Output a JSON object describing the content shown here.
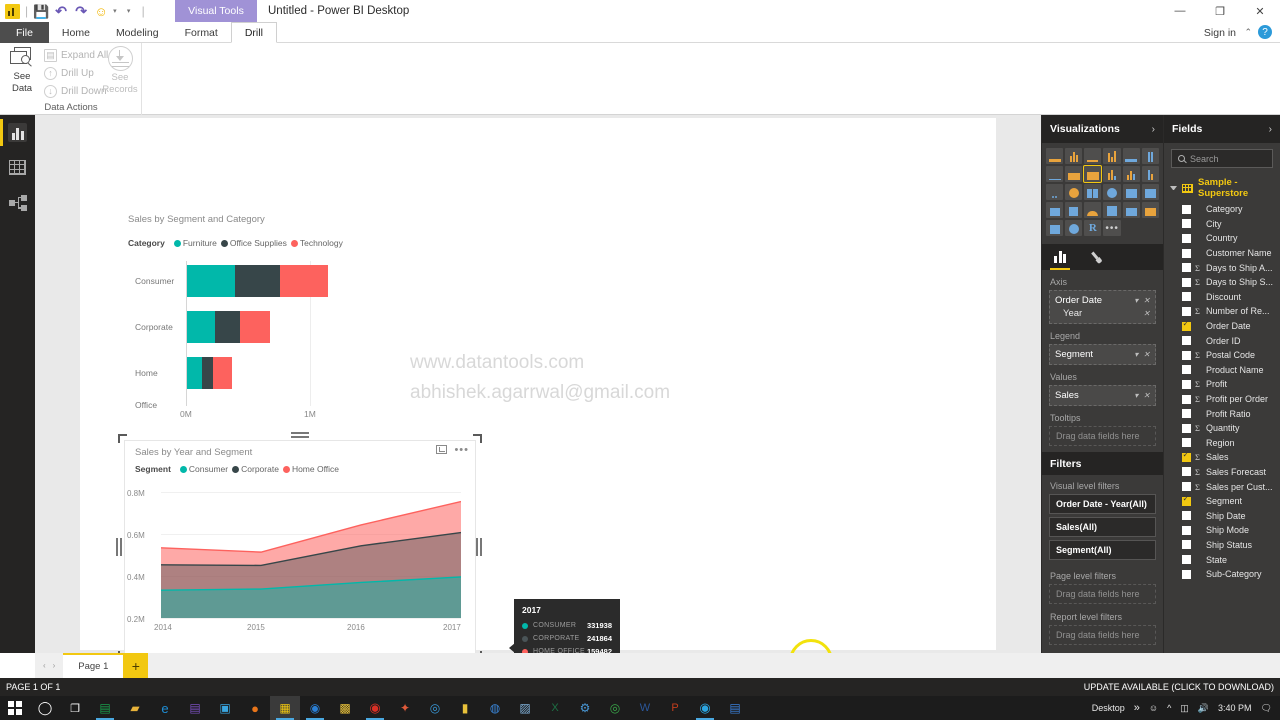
{
  "titlebar": {
    "quick_access": [
      "pbi-logo",
      "save-icon",
      "undo-icon",
      "redo-icon",
      "smiley-icon",
      "customize-caret"
    ],
    "contextual_tab": "Visual Tools",
    "window_title": "Untitled - Power BI Desktop",
    "minimize": "—",
    "maximize": "❐",
    "close": "✕"
  },
  "ribbon": {
    "tabs": [
      "File",
      "Home",
      "Modeling",
      "Format",
      "Drill"
    ],
    "active_tab": "Drill",
    "sign_in": "Sign in",
    "collapse_caret": "⌃",
    "help": "?",
    "group_label": "Data Actions",
    "see_data": "See\nData",
    "see_data_line1": "See",
    "see_data_line2": "Data",
    "commands": [
      "Expand All",
      "Drill Up",
      "Drill Down"
    ],
    "see_records_line1": "See",
    "see_records_line2": "Records"
  },
  "viewbar": {
    "items": [
      "report-view",
      "data-view",
      "model-view"
    ],
    "selected": "report-view"
  },
  "canvas": {
    "watermark_line1": "www.datantools.com",
    "watermark_line2": "abhishek.agarrwal@gmail.com"
  },
  "colors": {
    "consumer": "#01B8AA",
    "corporate": "#374649",
    "home_office": "#FD625E",
    "furniture": "#01B8AA",
    "office_supplies": "#374649",
    "technology": "#FD625E",
    "accent_yellow": "#F2C811",
    "panel_bg": "#3B3A39",
    "panel_head": "#252423",
    "cursor_ring": "#F2E20C"
  },
  "chart_data": [
    {
      "type": "bar",
      "id": "sales-by-segment-and-category",
      "title": "Sales by Segment and Category",
      "orientation": "horizontal",
      "stacked": true,
      "legend_title": "Category",
      "legend_position": "top",
      "categories": [
        "Consumer",
        "Corporate",
        "Home Office"
      ],
      "xlabel": "",
      "ylabel": "",
      "xlim": [
        0,
        1.15
      ],
      "xticks": [
        "0M",
        "1M"
      ],
      "xtick_values": [
        0,
        1000000
      ],
      "grid": false,
      "series": [
        {
          "name": "Furniture",
          "color": "#01B8AA",
          "values": [
            391000,
            230000,
            124000
          ]
        },
        {
          "name": "Office Supplies",
          "color": "#374649",
          "values": [
            366000,
            205000,
            89000
          ]
        },
        {
          "name": "Technology",
          "color": "#FD625E",
          "values": [
            391000,
            247000,
            158000
          ]
        }
      ],
      "totals": [
        1148000,
        682000,
        371000
      ],
      "units": "USD"
    },
    {
      "type": "area",
      "id": "sales-by-year-and-segment",
      "title": "Sales by Year and Segment",
      "stacked": true,
      "legend_title": "Segment",
      "legend_position": "top",
      "x": [
        "2014",
        "2015",
        "2016",
        "2017"
      ],
      "xlabel": "",
      "ylabel": "",
      "ylim": [
        0.2,
        0.85
      ],
      "yticks": [
        "0.2M",
        "0.4M",
        "0.6M",
        "0.8M"
      ],
      "ytick_values": [
        200000,
        400000,
        600000,
        800000
      ],
      "grid": true,
      "series": [
        {
          "name": "Consumer",
          "color": "#01B8AA",
          "values": [
            263000,
            269000,
            303000,
            331938
          ]
        },
        {
          "name": "Corporate",
          "color": "#374649",
          "values": [
            131000,
            128000,
            202000,
            241864
          ]
        },
        {
          "name": "Home Office",
          "color": "#FD625E",
          "values": [
            89000,
            77000,
            108000,
            159482
          ]
        }
      ],
      "cumulative": [
        [
          263000,
          269000,
          303000,
          331938
        ],
        [
          394000,
          397000,
          505000,
          573802
        ],
        [
          483000,
          474000,
          613000,
          733284
        ]
      ],
      "units": "USD"
    }
  ],
  "tooltip": {
    "title": "2017",
    "rows": [
      {
        "label": "CONSUMER",
        "value": "331938",
        "color": "#01B8AA"
      },
      {
        "label": "CORPORATE",
        "value": "241864",
        "color": "#374649"
      },
      {
        "label": "HOME OFFICE",
        "value": "159482",
        "color": "#FD625E"
      }
    ]
  },
  "visualizations": {
    "header": "Visualizations",
    "chevron": "›",
    "icon_grid": [
      "stacked-bar-chart-icon",
      "stacked-column-chart-icon",
      "clustered-bar-chart-icon",
      "clustered-column-chart-icon",
      "100-stacked-bar-chart-icon",
      "100-stacked-column-chart-icon",
      "line-chart-icon",
      "area-chart-icon",
      "stacked-area-chart-icon",
      "line-stacked-column-icon",
      "line-clustered-column-icon",
      "ribbon-chart-icon",
      "scatter-chart-icon",
      "pie-chart-icon",
      "treemap-icon",
      "map-icon",
      "filled-map-icon",
      "matrix-icon",
      "funnel-icon",
      "funnel-chart-icon",
      "gauge-icon",
      "card-icon",
      "multi-row-card-icon",
      "kpi-icon",
      "slicer-icon",
      "r-script-visual-icon",
      "r-letter-icon",
      "more-options-icon"
    ],
    "selected_icon": "stacked-area-chart-icon",
    "tabs": [
      "fields-pane-icon",
      "format-pane-icon"
    ],
    "active_tab": "fields-pane-icon",
    "wells": [
      {
        "label": "Axis",
        "value": "Order Date",
        "sub": "Year",
        "caret": "▾",
        "remove": "✕"
      },
      {
        "label": "Legend",
        "value": "Segment",
        "sub": null,
        "caret": "▾",
        "remove": "✕"
      },
      {
        "label": "Values",
        "value": "Sales",
        "sub": null,
        "caret": "▾",
        "remove": "✕"
      },
      {
        "label": "Tooltips",
        "value": null,
        "placeholder": "Drag data fields here"
      }
    ]
  },
  "filters": {
    "header": "Filters",
    "zones": [
      {
        "label": "Visual level filters",
        "cards": [
          "Order Date - Year(All)",
          "Sales(All)",
          "Segment(All)"
        ]
      },
      {
        "label": "Page level filters",
        "placeholder": "Drag data fields here"
      },
      {
        "label": "Report level filters",
        "placeholder": "Drag data fields here"
      }
    ]
  },
  "fields": {
    "header": "Fields",
    "chevron": "›",
    "search_placeholder": "Search",
    "table_name": "Sample - Superstore",
    "items": [
      {
        "name": "Category",
        "checked": false,
        "measure": false
      },
      {
        "name": "City",
        "checked": false,
        "measure": false
      },
      {
        "name": "Country",
        "checked": false,
        "measure": false
      },
      {
        "name": "Customer Name",
        "checked": false,
        "measure": false
      },
      {
        "name": "Days to Ship A...",
        "checked": false,
        "measure": true
      },
      {
        "name": "Days to Ship S...",
        "checked": false,
        "measure": true
      },
      {
        "name": "Discount",
        "checked": false,
        "measure": false
      },
      {
        "name": "Number of Re...",
        "checked": false,
        "measure": true
      },
      {
        "name": "Order Date",
        "checked": true,
        "measure": false
      },
      {
        "name": "Order ID",
        "checked": false,
        "measure": false
      },
      {
        "name": "Postal Code",
        "checked": false,
        "measure": true
      },
      {
        "name": "Product Name",
        "checked": false,
        "measure": false
      },
      {
        "name": "Profit",
        "checked": false,
        "measure": true
      },
      {
        "name": "Profit per Order",
        "checked": false,
        "measure": true
      },
      {
        "name": "Profit Ratio",
        "checked": false,
        "measure": false
      },
      {
        "name": "Quantity",
        "checked": false,
        "measure": true
      },
      {
        "name": "Region",
        "checked": false,
        "measure": false
      },
      {
        "name": "Sales",
        "checked": true,
        "measure": true
      },
      {
        "name": "Sales Forecast",
        "checked": false,
        "measure": true
      },
      {
        "name": "Sales per Cust...",
        "checked": false,
        "measure": true
      },
      {
        "name": "Segment",
        "checked": true,
        "measure": false
      },
      {
        "name": "Ship Date",
        "checked": false,
        "measure": false
      },
      {
        "name": "Ship Mode",
        "checked": false,
        "measure": false
      },
      {
        "name": "Ship Status",
        "checked": false,
        "measure": false
      },
      {
        "name": "State",
        "checked": false,
        "measure": false
      },
      {
        "name": "Sub-Category",
        "checked": false,
        "measure": false
      }
    ]
  },
  "pagebar": {
    "prev": "‹",
    "next": "›",
    "tabs": [
      "Page 1"
    ],
    "active_tab": "Page 1",
    "add_label": "+"
  },
  "statusbar": {
    "left": "PAGE 1 OF 1",
    "right": "UPDATE AVAILABLE (CLICK TO DOWNLOAD)"
  },
  "taskbar": {
    "start": "windows-start-icon",
    "items": [
      "cortana-search-icon",
      "task-view-icon",
      "spreadsheet-app-icon",
      "file-explorer-icon",
      "edge-browser-icon",
      "onenote-icon",
      "store-icon",
      "firefox-icon",
      "power-bi-desktop-icon",
      "r-studio-icon",
      "calculator-icon",
      "chrome-icon",
      "paint-icon",
      "media-player-icon",
      "notes-icon",
      "globe-app-icon",
      "utility-icon",
      "excel-icon",
      "settings-app-icon",
      "antivirus-icon",
      "word-icon",
      "powerpoint-icon",
      "telegram-icon",
      "editor-icon"
    ],
    "tray": {
      "desktop_label": "Desktop",
      "overflow": "»",
      "people_icon": "people-icon",
      "show_hidden": "^",
      "battery_icon": "battery-icon",
      "volume_icon": "volume-icon",
      "time": "3:40 PM",
      "action_center": "action-center-icon"
    }
  }
}
